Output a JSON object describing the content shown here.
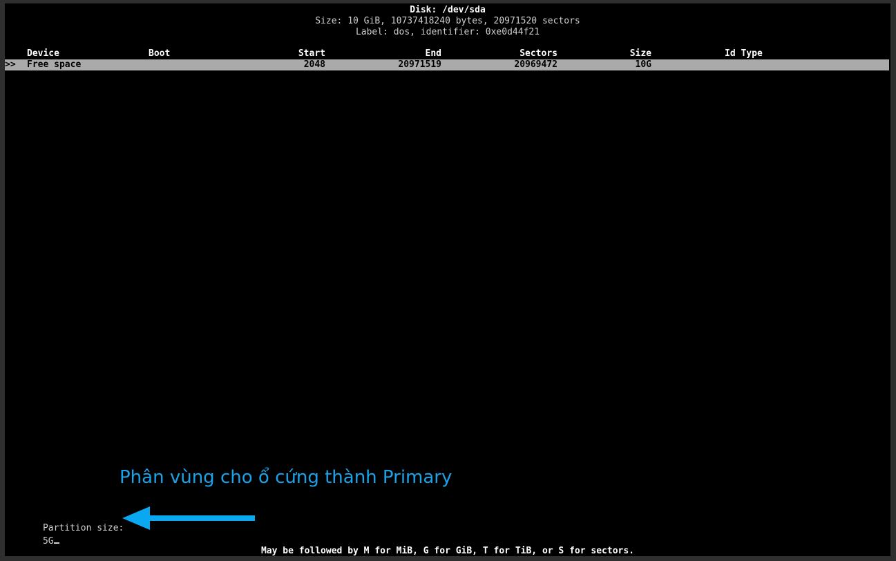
{
  "header": {
    "disk": "Disk: /dev/sda",
    "size": "Size: 10 GiB, 10737418240 bytes, 20971520 sectors",
    "label": "Label: dos, identifier: 0xe0d44f21"
  },
  "columns": {
    "device": "Device",
    "boot": "Boot",
    "start": "Start",
    "end": "End",
    "sectors": "Sectors",
    "size": "Size",
    "idtype": "Id Type"
  },
  "selected_row": {
    "marker": ">>",
    "device": "Free space",
    "boot": "",
    "start": "2048",
    "end": "20971519",
    "sectors": "20969472",
    "size": "10G",
    "idtype": ""
  },
  "annotation": {
    "text": "Phân vùng cho ổ cứng thành Primary",
    "color": "#1aa3e8"
  },
  "prompt": {
    "label": "Partition size:",
    "value": "5G"
  },
  "hint": "May be followed by M for MiB, G for GiB, T for TiB, or S for sectors."
}
